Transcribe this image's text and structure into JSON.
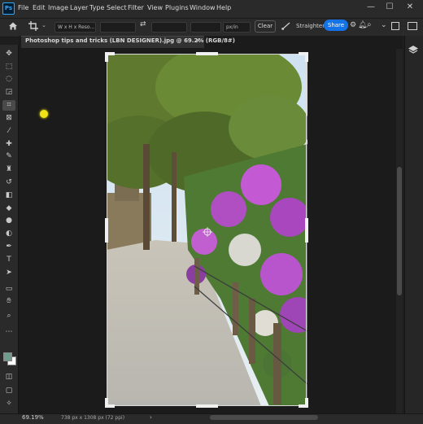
{
  "app": {
    "logo": "Ps",
    "name": "Photoshop"
  },
  "menubar": {
    "items": [
      "File",
      "Edit",
      "Image",
      "Layer",
      "Type",
      "Select",
      "Filter",
      "View",
      "Plugins",
      "Window",
      "Help"
    ],
    "window_controls": {
      "minimize": "—",
      "maximize": "☐",
      "close": "✕"
    }
  },
  "options": {
    "ratio_select": "W x H x Reso...",
    "unit_select": "px/in",
    "clear_label": "Clear",
    "straighten_label": "Straighten",
    "share_label": "Share"
  },
  "document": {
    "tab_title": "Photoshop tips and tricks (LBN DESIGNER).jpg @ 69.2% (RGB/8#)",
    "close_glyph": "×"
  },
  "status": {
    "zoom": "69.19%",
    "doc_info": "738 px x 1308 px (72 ppi)"
  },
  "colors": {
    "accent": "#1473e6",
    "foreground_swatch": "#6f9c8c",
    "background_swatch": "#ffffff"
  },
  "tools": [
    "move-icon",
    "marquee-icon",
    "lasso-icon",
    "object-select-icon",
    "crop-icon",
    "frame-icon",
    "eyedropper-icon",
    "spot-heal-icon",
    "brush-icon",
    "clone-stamp-icon",
    "history-brush-icon",
    "eraser-icon",
    "paint-bucket-icon",
    "blur-icon",
    "dodge-icon",
    "pen-icon",
    "type-icon",
    "path-select-icon",
    "rectangle-icon",
    "hand-icon",
    "zoom-icon",
    "more-tools-icon"
  ]
}
